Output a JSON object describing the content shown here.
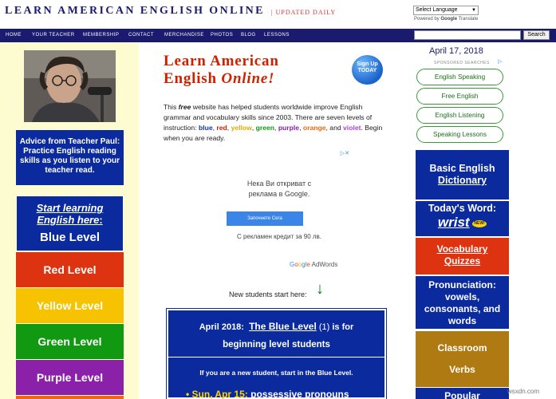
{
  "header": {
    "site_title": "LEARN AMERICAN ENGLISH ONLINE",
    "updated": "| UPDATED DAILY",
    "language_select": "Select Language",
    "powered_by_prefix": "Powered by",
    "powered_by_google": "Google",
    "powered_by_translate": "Translate"
  },
  "nav": {
    "items": [
      "HOME",
      "YOUR TEACHER",
      "MEMBERSHIP",
      "CONTACT",
      "MERCHANDISE",
      "PHOTOS",
      "BLOG",
      "LESSONS"
    ],
    "search_value": "",
    "search_button": "Search"
  },
  "left": {
    "advice": "Advice from Teacher Paul: Practice English reading skills as you listen to your teacher read.",
    "start_learning": "Start learning English here",
    "start_colon": ":",
    "blue_level": "Blue Level",
    "red_level": "Red Level",
    "yellow_level": "Yellow Level",
    "green_level": "Green Level",
    "purple_level": "Purple Level"
  },
  "main": {
    "title_line1": "Learn American",
    "title_line2": "English",
    "title_online": "Online!",
    "signup_line1": "Sign Up",
    "signup_line2": "TODAY",
    "intro": {
      "p1": "This ",
      "free": "free",
      "p2": " website has helped students worldwide improve English grammar and vocabulary skills since 2003. There are seven levels of instruction: ",
      "blue": "blue",
      "comma1": ", ",
      "red": "red",
      "comma2": ", ",
      "yellow": "yellow",
      "comma3": ", ",
      "green": "green",
      "comma4": ", ",
      "purple": "purple",
      "comma5": ", ",
      "orange": "orange",
      "and": ", and ",
      "violet": "violet",
      "p3": ". Begin when you are ready."
    },
    "ad": {
      "choices_icon": "adchoices-icon",
      "line1": "Нека Ви откриват с",
      "line1b": "реклама в Google.",
      "button": "Започнете Сега",
      "line3": "С рекламен кредит за 90 лв.",
      "brand_google": "Google",
      "brand_adwords": "AdWords"
    },
    "new_students": "New students start here:",
    "down_arrow": "↓",
    "panel": {
      "month": "April 2018:",
      "level_link": "The Blue Level",
      "level_num": "(1)",
      "is_for": "is for",
      "beginning": "beginning level students",
      "new_student": "If you are a new student, start in the Blue Level.",
      "bullet": "•",
      "item_date": "Sun, Apr 15:",
      "item_text": "possessive pronouns"
    }
  },
  "right": {
    "date": "April 17, 2018",
    "sponsored": "SPONSORED SEARCHES",
    "sponsored_icon": "adchoices-icon",
    "pills": [
      "English Speaking",
      "Free English",
      "English Listening",
      "Speaking Lessons"
    ],
    "dict_line1": "Basic English",
    "dict_line2": "Dictionary",
    "word_label": "Today's Word:",
    "word": "wrist",
    "new_badge": "NEW!",
    "vocab_line1": "Vocabulary",
    "vocab_line2": "Quizzes",
    "pron": "Pronunciation: vowels, consonants, and words",
    "verbs_line1": "Classroom",
    "verbs_line2": "Verbs",
    "popular": "Popular"
  },
  "watermark": "wsxdn.com",
  "colors": {
    "navy": "#1a1a6e",
    "blue_box": "#0a2a9e",
    "red": "#dd3311",
    "yellow": "#f7c300",
    "green": "#119911",
    "purple": "#8a21a8",
    "orange": "#ee6611",
    "brown": "#b07a12",
    "left_bg": "#fdfbd0"
  }
}
